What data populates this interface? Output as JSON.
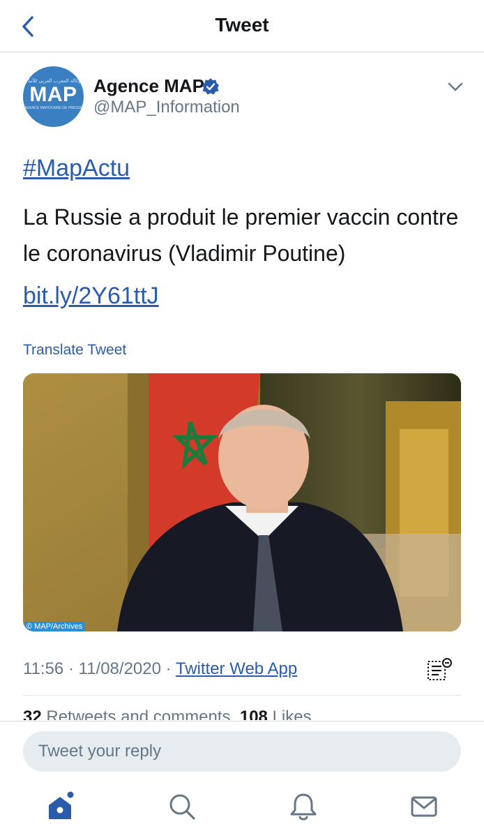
{
  "header": {
    "title": "Tweet"
  },
  "author": {
    "name": "Agence MAP",
    "handle": "@MAP_Information",
    "avatar_text": "MAP",
    "avatar_arabic": "وكالة المغرب العربي للأنباء",
    "avatar_subtitle": "AGENCE MAROCAINE DE PRESSE",
    "verified": true
  },
  "tweet": {
    "hashtag": "#MapActu",
    "text": "La Russie a produit le premier vaccin contre le coronavirus (Vladimir Poutine)",
    "link": "bit.ly/2Y61ttJ",
    "translate_label": "Translate Tweet",
    "media_watermark": "© MAP/Archives",
    "time": "11:56",
    "date": "11/08/2020",
    "separator": "·",
    "source": "Twitter Web App"
  },
  "stats": {
    "retweets_count": "32",
    "retweets_label": "Retweets and comments",
    "likes_count": "108",
    "likes_label": "Likes"
  },
  "reply": {
    "placeholder": "Tweet your reply"
  },
  "tabs": [
    "home-icon",
    "search-icon",
    "notifications-icon",
    "messages-icon"
  ],
  "colors": {
    "accent": "#2b5cab",
    "text": "#14171a",
    "secondary": "#657786",
    "avatar_bg": "#3a7fc2"
  }
}
